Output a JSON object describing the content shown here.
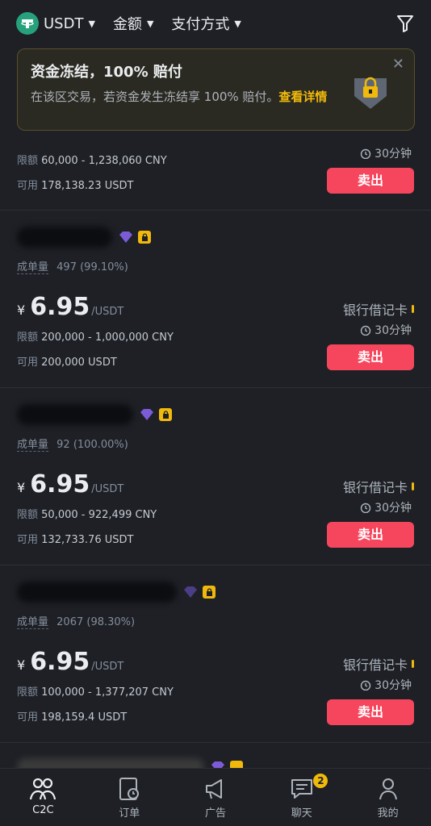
{
  "topbar": {
    "coin": "USDT",
    "amount_label": "金额",
    "payment_label": "支付方式"
  },
  "banner": {
    "title": "资金冻结，100% 赔付",
    "text": "在该区交易，若资金发生冻结享 100% 赔付。",
    "link": "查看详情"
  },
  "labels": {
    "limit": "限额",
    "available": "可用",
    "volume": "成单量",
    "sell": "卖出",
    "price_unit": "/USDT",
    "yen": "¥"
  },
  "partial_card": {
    "limit": "60,000 - 1,238,060 CNY",
    "available": "178,138.23 USDT",
    "time": "30分钟"
  },
  "listings": [
    {
      "orders": "497 (99.10%)",
      "price": "6.95",
      "payment": "银行借记卡",
      "time": "30分钟",
      "limit": "200,000 - 1,000,000 CNY",
      "available": "200,000 USDT"
    },
    {
      "orders": "92 (100.00%)",
      "price": "6.95",
      "payment": "银行借记卡",
      "time": "30分钟",
      "limit": "50,000 - 922,499 CNY",
      "available": "132,733.76 USDT"
    },
    {
      "orders": "2067 (98.30%)",
      "price": "6.95",
      "payment": "银行借记卡",
      "time": "30分钟",
      "limit": "100,000 - 1,377,207 CNY",
      "available": "198,159.4 USDT"
    }
  ],
  "nav": {
    "c2c": "C2C",
    "orders": "订单",
    "ads": "广告",
    "chat": "聊天",
    "chat_badge": "2",
    "me": "我的"
  },
  "colors": {
    "accent": "#f0b90b",
    "sell": "#f6465d",
    "background": "#1e2026"
  }
}
